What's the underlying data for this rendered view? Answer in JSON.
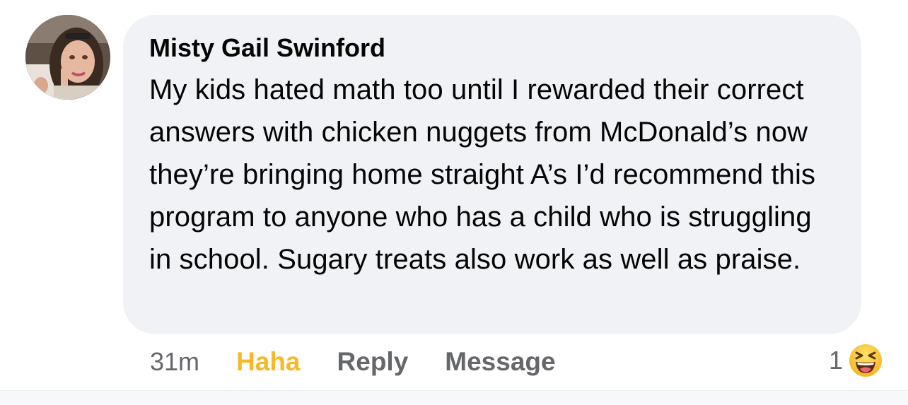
{
  "comment": {
    "author": "Misty Gail Swinford",
    "text": "My kids hated math too until I rewarded their correct answers with chicken nuggets from McDonald’s now they’re bringing home straight A’s I’d recommend this program to anyone who has a child who is struggling in school. Sugary treats also work as well as praise."
  },
  "actions": {
    "time": "31m",
    "haha_label": "Haha",
    "reply_label": "Reply",
    "message_label": "Message"
  },
  "reactions": {
    "count": "1",
    "icon": "haha-emoji-icon"
  },
  "colors": {
    "bubble_bg": "#f0f2f5",
    "text": "#050505",
    "secondary": "#65676b",
    "haha_active": "#f7b928"
  }
}
